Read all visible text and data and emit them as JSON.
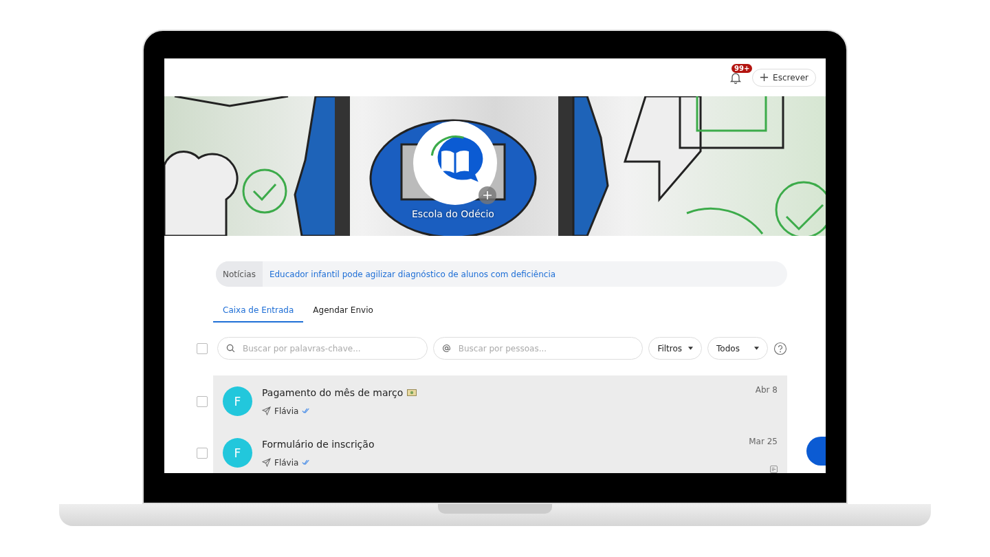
{
  "header": {
    "notifications": {
      "badge": "99+"
    },
    "compose_button": {
      "label": "Escrever"
    }
  },
  "banner": {
    "school_name": "Escola do Odécio"
  },
  "news": {
    "label": "Notícias",
    "headline": "Educador infantil pode agilizar diagnóstico de alunos com deficiência"
  },
  "tabs": [
    {
      "label": "Caixa de Entrada",
      "selected": true
    },
    {
      "label": "Agendar Envio",
      "selected": false
    }
  ],
  "toolbar": {
    "select_all": {
      "checked": false
    },
    "keyword_search": {
      "placeholder": "Buscar por palavras-chave..."
    },
    "people_search": {
      "placeholder": "Buscar por pessoas..."
    },
    "filters": "Filtros",
    "scope": "Todos"
  },
  "messages": [
    {
      "checked": false,
      "avatar": "F",
      "title": "Pagamento do mês de março",
      "banknote": true,
      "sender": "Flávia",
      "read": true,
      "date": "Abr 8",
      "attachment": false
    },
    {
      "checked": false,
      "avatar": "F",
      "title": "Formulário de inscrição",
      "banknote": false,
      "sender": "Flávia",
      "read": true,
      "date": "Mar 25",
      "attachment": true
    }
  ]
}
